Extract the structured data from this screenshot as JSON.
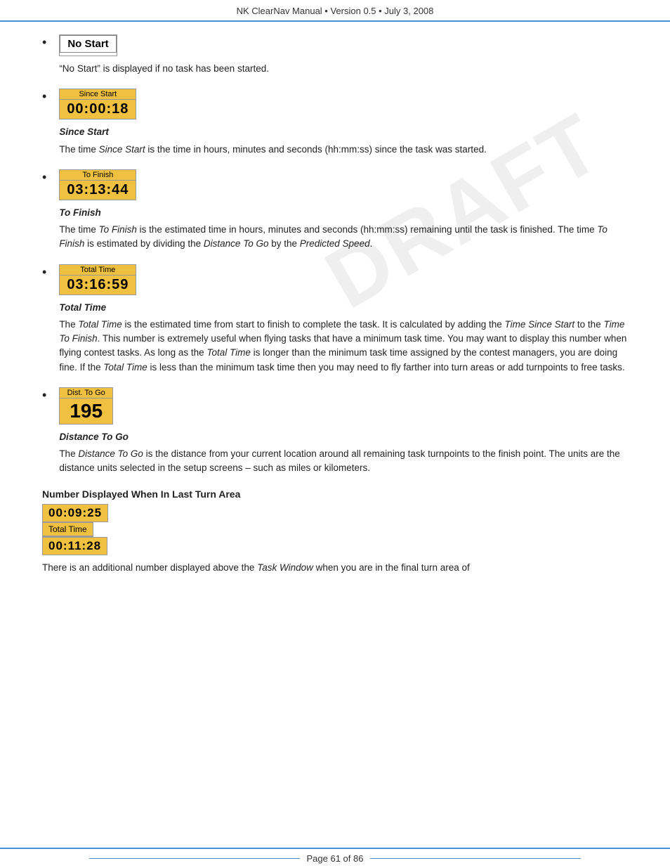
{
  "header": {
    "text": "NK ClearNav Manual • Version 0.5 • July 3, 2008"
  },
  "footer": {
    "text": "Page 61 of 86"
  },
  "draft_watermark": "DRAFT",
  "bullets": [
    {
      "id": "no-start",
      "widget_type": "no_start",
      "widget_label": "No Start",
      "desc_plain_prefix": "“No Start” is displayed if no task has been started.",
      "desc_parts": []
    },
    {
      "id": "since-start",
      "widget_type": "timer",
      "widget_label": "Since Start",
      "widget_value": "00:00:18",
      "section_title": "Since Start",
      "desc_parts": [
        {
          "text": "The time "
        },
        {
          "text": "Since Start",
          "style": "italic"
        },
        {
          "text": " is the time in hours, minutes and seconds (hh:mm:ss) since the task was started."
        }
      ]
    },
    {
      "id": "to-finish",
      "widget_type": "timer",
      "widget_label": "To Finish",
      "widget_value": "03:13:44",
      "section_title": "To Finish",
      "desc_parts": [
        {
          "text": "The time "
        },
        {
          "text": "To Finish",
          "style": "italic"
        },
        {
          "text": " is the estimated time in hours, minutes and seconds (hh:mm:ss) remaining until the task is finished.  The time "
        },
        {
          "text": "To Finish",
          "style": "italic"
        },
        {
          "text": " is estimated by dividing the "
        },
        {
          "text": "Distance To Go",
          "style": "italic"
        },
        {
          "text": " by the "
        },
        {
          "text": "Predicted Speed",
          "style": "italic"
        },
        {
          "text": "."
        }
      ]
    },
    {
      "id": "total-time",
      "widget_type": "timer",
      "widget_label": "Total Time",
      "widget_value": "03:16:59",
      "section_title": "Total Time",
      "desc_parts": [
        {
          "text": "The "
        },
        {
          "text": "Total Time",
          "style": "italic"
        },
        {
          "text": " is the estimated time from start to finish to complete the task.  It is calculated by adding the "
        },
        {
          "text": "Time Since Start",
          "style": "italic"
        },
        {
          "text": " to the "
        },
        {
          "text": "Time To Finish",
          "style": "italic"
        },
        {
          "text": ".  This number is extremely useful when flying tasks that have a minimum task time.  You may want to display this number when flying contest tasks.  As long as the "
        },
        {
          "text": "Total Time",
          "style": "italic"
        },
        {
          "text": " is longer than the minimum task time assigned by the contest managers, you are doing fine.  If the "
        },
        {
          "text": "Total Time",
          "style": "italic"
        },
        {
          "text": " is less than the minimum task time then you may need to fly farther into turn areas or add turnpoints to free tasks."
        }
      ]
    },
    {
      "id": "dist-to-go",
      "widget_type": "distance",
      "widget_label": "Dist. To Go",
      "widget_value": "195",
      "section_title": "Distance To Go",
      "desc_parts": [
        {
          "text": "The "
        },
        {
          "text": "Distance To Go",
          "style": "italic"
        },
        {
          "text": " is the distance from your current location around all remaining task turnpoints to the finish point.  The units are the distance units selected in the setup screens – such as miles or kilometers."
        }
      ]
    }
  ],
  "number_section": {
    "heading": "Number Displayed When In Last Turn Area",
    "widgets": [
      {
        "label": "00:09:25",
        "type": "top_value"
      },
      {
        "label": "Total Time",
        "type": "middle_label"
      },
      {
        "label": "00:11:28",
        "type": "bottom_value"
      }
    ],
    "desc_parts": [
      {
        "text": "There is an additional number displayed above the "
      },
      {
        "text": "Task Window",
        "style": "italic"
      },
      {
        "text": " when you are in the final turn area of"
      }
    ]
  }
}
